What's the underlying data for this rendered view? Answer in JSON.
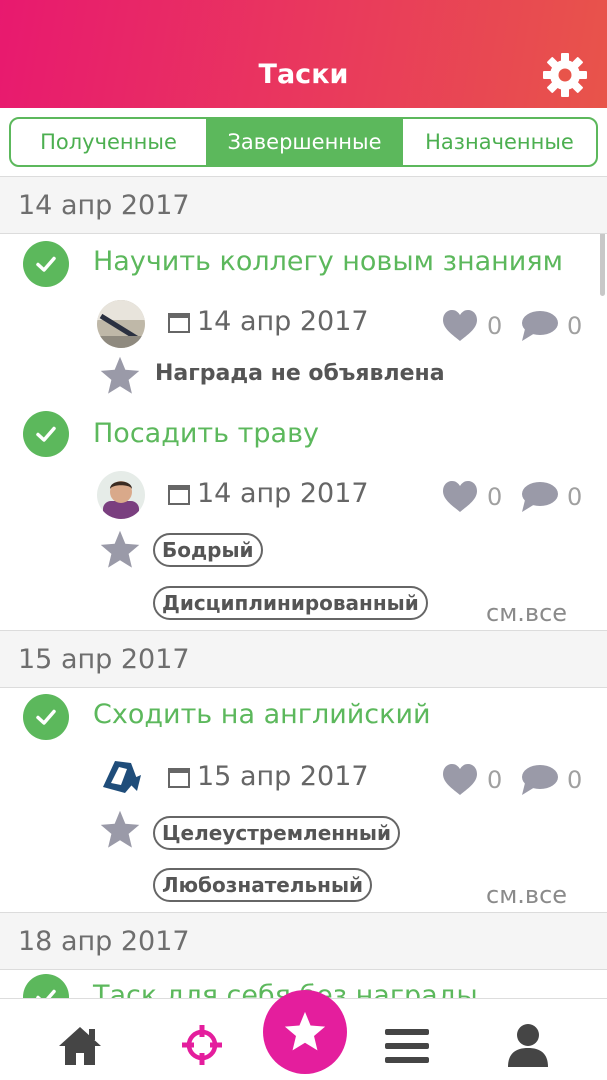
{
  "header": {
    "title": "Таски",
    "settings_icon": "gear-icon"
  },
  "tabs": [
    {
      "label": "Полученные",
      "active": false
    },
    {
      "label": "Завершенные",
      "active": true
    },
    {
      "label": "Назначенные",
      "active": false
    }
  ],
  "groups": [
    {
      "date": "14 апр 2017",
      "tasks": [
        {
          "title": "Научить коллегу новым знаниям",
          "date": "14 апр 2017",
          "likes": "0",
          "comments": "0",
          "reward_text": "Награда не объявлена",
          "badges": []
        },
        {
          "title": "Посадить траву",
          "date": "14 апр 2017",
          "likes": "0",
          "comments": "0",
          "badges": [
            "Бодрый",
            "Дисциплинированный"
          ],
          "see_all": "см.все"
        }
      ]
    },
    {
      "date": "15 апр 2017",
      "tasks": [
        {
          "title": "Сходить на английский",
          "date": "15 апр 2017",
          "likes": "0",
          "comments": "0",
          "badges": [
            "Целеустремленный",
            "Любознательный"
          ],
          "see_all": "см.все"
        }
      ]
    },
    {
      "date": "18 апр 2017",
      "tasks": [
        {
          "title": "Таск для себя без награды"
        }
      ]
    }
  ],
  "bottom_nav": {
    "items": [
      "home-icon",
      "target-icon",
      "star-icon",
      "menu-icon",
      "profile-icon"
    ],
    "active": "target-icon"
  },
  "colors": {
    "header_gradient_start": "#e8196f",
    "header_gradient_end": "#e8544a",
    "accent_green": "#5cb85c",
    "accent_pink": "#e41e9d",
    "icon_gray": "#9a9aa8"
  }
}
